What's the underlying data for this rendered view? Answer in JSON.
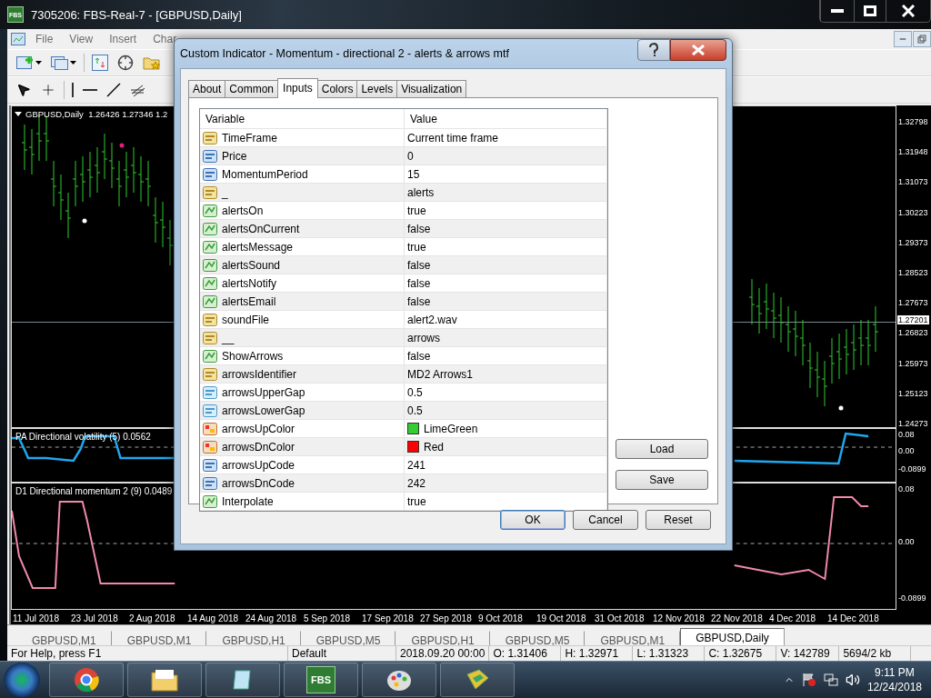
{
  "window": {
    "logo": "FBS",
    "title": "7305206: FBS-Real-7 - [GBPUSD,Daily]"
  },
  "menu": [
    "File",
    "View",
    "Insert",
    "Char"
  ],
  "chart": {
    "header": "GBPUSD,Daily  1.26426 1.27346 1.2",
    "price_axis": [
      "1.32798",
      "1.31948",
      "1.31073",
      "1.30223",
      "1.29373",
      "1.28523",
      "1.27673",
      "1.26823",
      "1.25973",
      "1.25123",
      "1.24273"
    ],
    "current_price": "1.27201",
    "indicators": [
      {
        "label": "PA Directional volatility (5) 0.0562",
        "axis": [
          "0.08",
          "0.00",
          "-0.0899"
        ]
      },
      {
        "label": "D1 Directional momentum 2 (9) 0.0489",
        "axis": [
          "0.08",
          "0.00",
          "-0.0899"
        ]
      }
    ],
    "dates": [
      "11 Jul 2018",
      "23 Jul 2018",
      "2 Aug 2018",
      "14 Aug 2018",
      "24 Aug 2018",
      "5 Sep 2018",
      "17 Sep 2018",
      "27 Sep 2018",
      "9 Oct 2018",
      "19 Oct 2018",
      "31 Oct 2018",
      "12 Nov 2018",
      "22 Nov 2018",
      "4 Dec 2018",
      "14 Dec 2018"
    ]
  },
  "chart_tabs": [
    {
      "label": "GBPUSD,M1",
      "selected": false
    },
    {
      "label": "GBPUSD,M1",
      "selected": false
    },
    {
      "label": "GBPUSD,H1",
      "selected": false
    },
    {
      "label": "GBPUSD,M5",
      "selected": false
    },
    {
      "label": "GBPUSD,H1",
      "selected": false
    },
    {
      "label": "GBPUSD,M5",
      "selected": false
    },
    {
      "label": "GBPUSD,M1",
      "selected": false
    },
    {
      "label": "GBPUSD,Daily",
      "selected": true
    }
  ],
  "status_bar": [
    "For Help, press F1",
    "Default",
    "2018.09.20 00:00",
    "O: 1.31406",
    "H: 1.32971",
    "L: 1.31323",
    "C: 1.32675",
    "V: 142789",
    "5694/2 kb"
  ],
  "dialog": {
    "title": "Custom Indicator - Momentum - directional 2 - alerts & arrows mtf",
    "tabs": [
      {
        "label": "About",
        "selected": false
      },
      {
        "label": "Common",
        "selected": false
      },
      {
        "label": "Inputs",
        "selected": true
      },
      {
        "label": "Colors",
        "selected": false
      },
      {
        "label": "Levels",
        "selected": false
      },
      {
        "label": "Visualization",
        "selected": false
      }
    ],
    "columns": [
      "Variable",
      "Value"
    ],
    "rows": [
      {
        "name": "TimeFrame",
        "value": "Current time frame",
        "kind": "string"
      },
      {
        "name": "Price",
        "value": "0",
        "kind": "int"
      },
      {
        "name": "MomentumPeriod",
        "value": "15",
        "kind": "int"
      },
      {
        "name": "_",
        "value": "alerts",
        "kind": "string"
      },
      {
        "name": "alertsOn",
        "value": "true",
        "kind": "bool"
      },
      {
        "name": "alertsOnCurrent",
        "value": "false",
        "kind": "bool"
      },
      {
        "name": "alertsMessage",
        "value": "true",
        "kind": "bool"
      },
      {
        "name": "alertsSound",
        "value": "false",
        "kind": "bool"
      },
      {
        "name": "alertsNotify",
        "value": "false",
        "kind": "bool"
      },
      {
        "name": "alertsEmail",
        "value": "false",
        "kind": "bool"
      },
      {
        "name": "soundFile",
        "value": "alert2.wav",
        "kind": "string"
      },
      {
        "name": "__",
        "value": "arrows",
        "kind": "string"
      },
      {
        "name": "ShowArrows",
        "value": "false",
        "kind": "bool"
      },
      {
        "name": "arrowsIdentifier",
        "value": "MD2 Arrows1",
        "kind": "string"
      },
      {
        "name": "arrowsUpperGap",
        "value": "0.5",
        "kind": "double"
      },
      {
        "name": "arrowsLowerGap",
        "value": "0.5",
        "kind": "double"
      },
      {
        "name": "arrowsUpColor",
        "value": "LimeGreen",
        "kind": "color",
        "color": "#32cd32"
      },
      {
        "name": "arrowsDnColor",
        "value": "Red",
        "kind": "color",
        "color": "#ff0000"
      },
      {
        "name": "arrowsUpCode",
        "value": "241",
        "kind": "int"
      },
      {
        "name": "arrowsDnCode",
        "value": "242",
        "kind": "int"
      },
      {
        "name": "Interpolate",
        "value": "true",
        "kind": "bool"
      }
    ],
    "side_buttons": [
      "Load",
      "Save"
    ],
    "buttons": [
      "OK",
      "Cancel",
      "Reset"
    ]
  },
  "taskbar": {
    "logo": "FBS",
    "time": "9:11 PM",
    "date": "12/24/2018"
  }
}
